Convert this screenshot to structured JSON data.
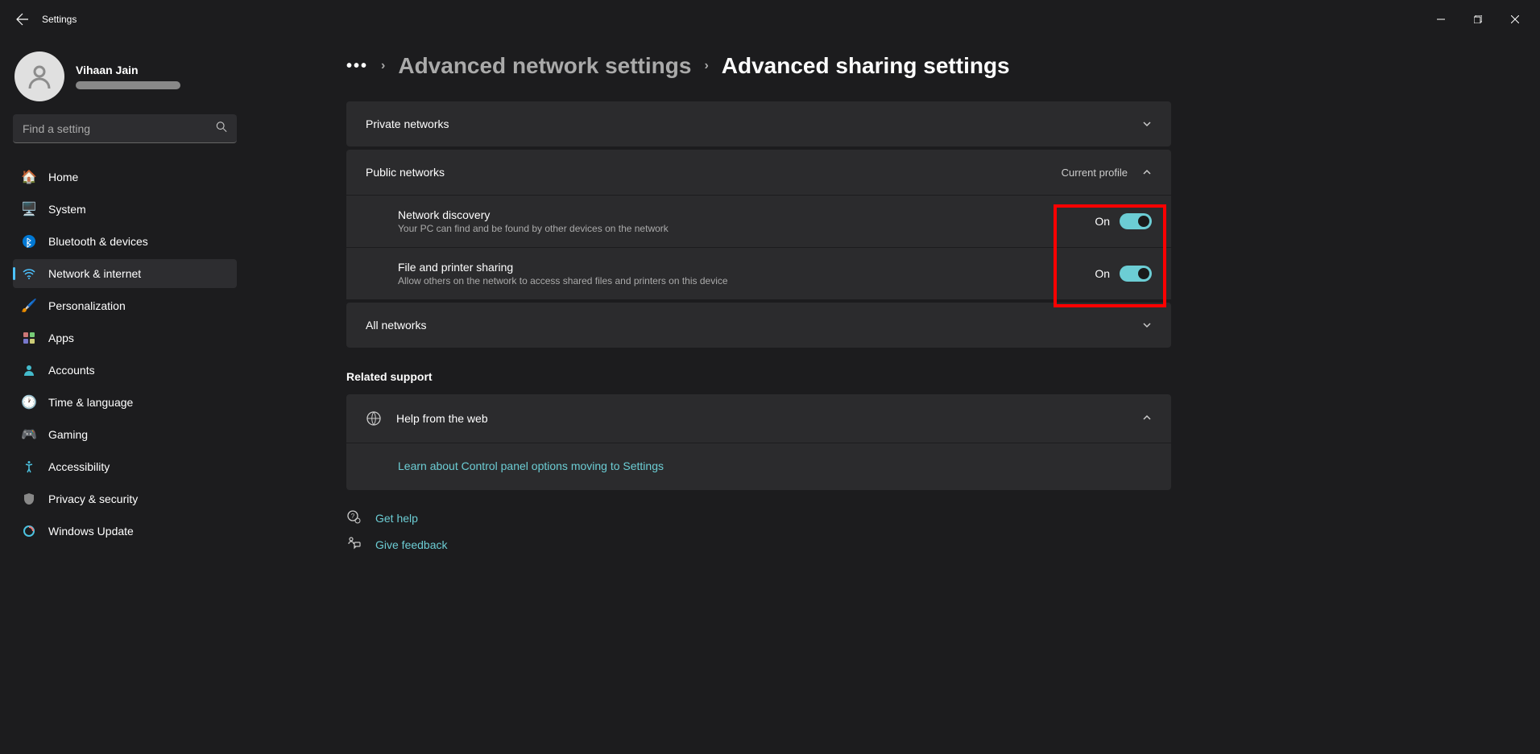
{
  "app": {
    "title": "Settings"
  },
  "user": {
    "name": "Vihaan Jain"
  },
  "search": {
    "placeholder": "Find a setting"
  },
  "nav": {
    "items": [
      {
        "label": "Home"
      },
      {
        "label": "System"
      },
      {
        "label": "Bluetooth & devices"
      },
      {
        "label": "Network & internet"
      },
      {
        "label": "Personalization"
      },
      {
        "label": "Apps"
      },
      {
        "label": "Accounts"
      },
      {
        "label": "Time & language"
      },
      {
        "label": "Gaming"
      },
      {
        "label": "Accessibility"
      },
      {
        "label": "Privacy & security"
      },
      {
        "label": "Windows Update"
      }
    ]
  },
  "breadcrumb": {
    "parent": "Advanced network settings",
    "current": "Advanced sharing settings"
  },
  "panels": {
    "private": {
      "title": "Private networks"
    },
    "public": {
      "title": "Public networks",
      "tag": "Current profile",
      "discovery": {
        "title": "Network discovery",
        "desc": "Your PC can find and be found by other devices on the network",
        "state": "On"
      },
      "file_sharing": {
        "title": "File and printer sharing",
        "desc": "Allow others on the network to access shared files and printers on this device",
        "state": "On"
      }
    },
    "all": {
      "title": "All networks"
    }
  },
  "related": {
    "title": "Related support",
    "help_header": "Help from the web",
    "help_link": "Learn about Control panel options moving to Settings"
  },
  "footer": {
    "get_help": "Get help",
    "feedback": "Give feedback"
  }
}
